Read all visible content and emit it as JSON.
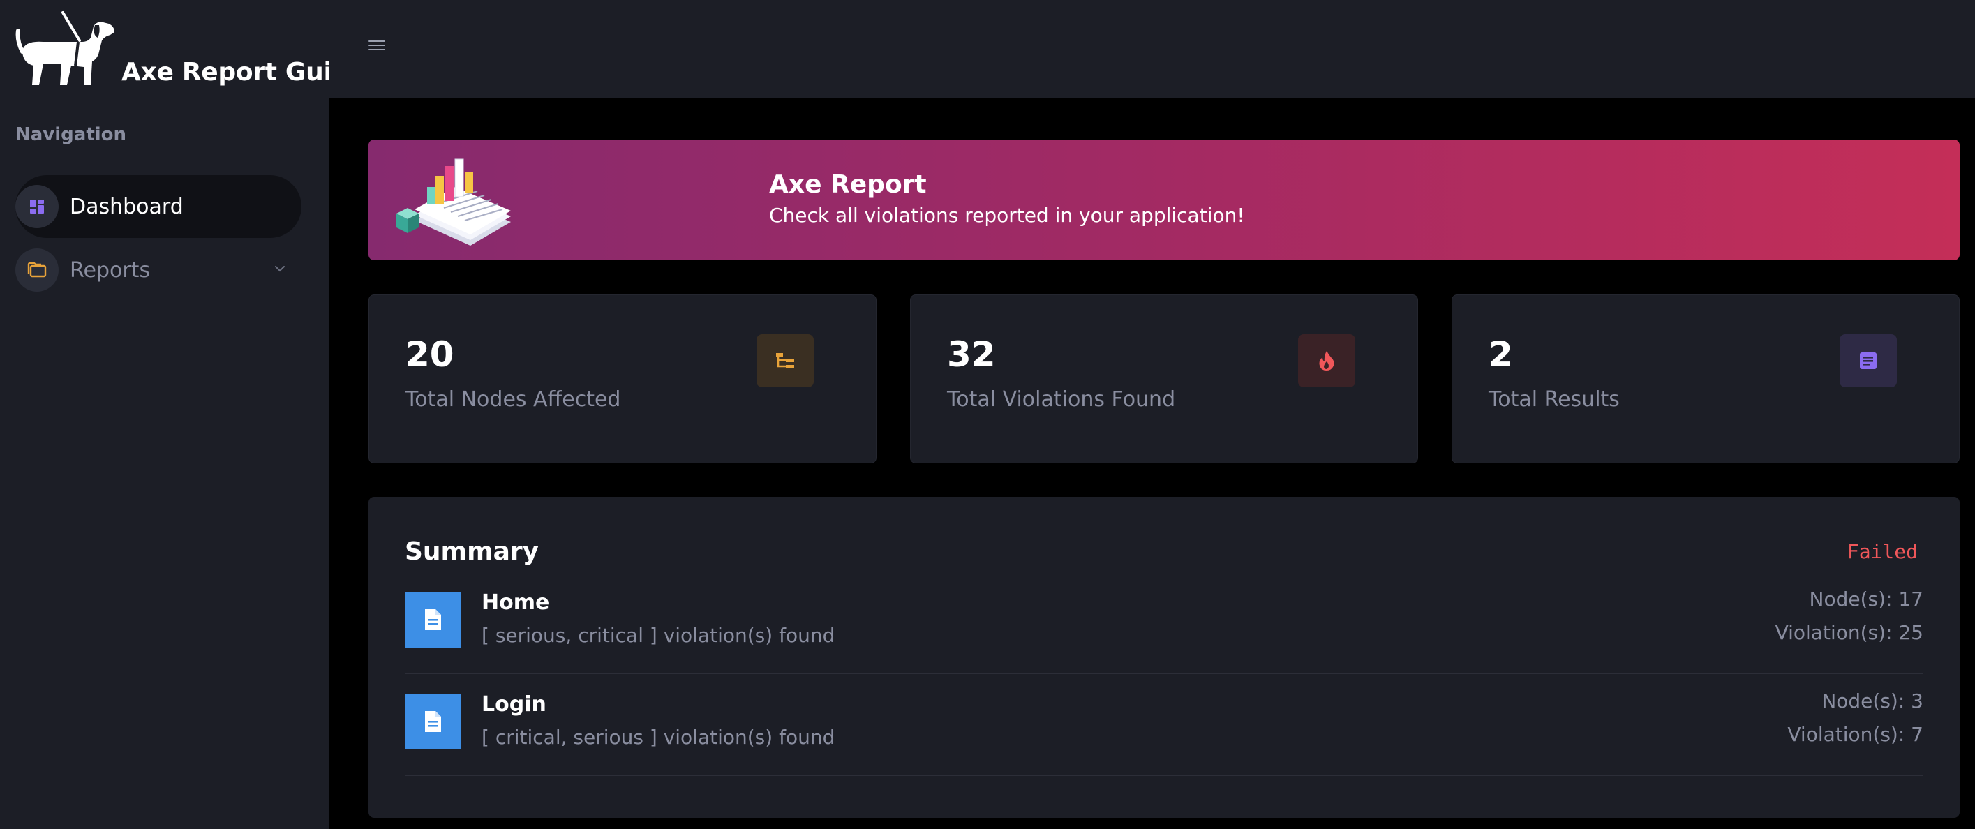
{
  "app": {
    "brand_name": "Axe Report Guide"
  },
  "sidebar": {
    "heading": "Navigation",
    "items": [
      {
        "label": "Dashboard",
        "icon": "dashboard-icon",
        "active": true
      },
      {
        "label": "Reports",
        "icon": "folder-icon",
        "active": false
      }
    ]
  },
  "banner": {
    "title": "Axe Report",
    "subtitle": "Check all violations reported in your application!"
  },
  "stats": [
    {
      "value": "20",
      "label": "Total Nodes Affected",
      "icon": "tree-icon",
      "color": "#e8a33a"
    },
    {
      "value": "32",
      "label": "Total Violations Found",
      "icon": "fire-icon",
      "color": "#f0575a"
    },
    {
      "value": "2",
      "label": "Total Results",
      "icon": "document-icon",
      "color": "#7c5ce6"
    }
  ],
  "summary": {
    "title": "Summary",
    "status": "Failed",
    "rows": [
      {
        "name": "Home",
        "desc": "[ serious, critical ] violation(s) found",
        "nodes": "Node(s): 17",
        "violations": "Violation(s): 25"
      },
      {
        "name": "Login",
        "desc": "[ critical, serious ] violation(s) found",
        "nodes": "Node(s): 3",
        "violations": "Violation(s): 7"
      }
    ]
  },
  "colors": {
    "accent": "#7c5ce6",
    "failed": "#f0575a",
    "doc_icon_bg": "#3d8fe6",
    "banner_start": "#862a6e",
    "banner_end": "#c42e58"
  }
}
